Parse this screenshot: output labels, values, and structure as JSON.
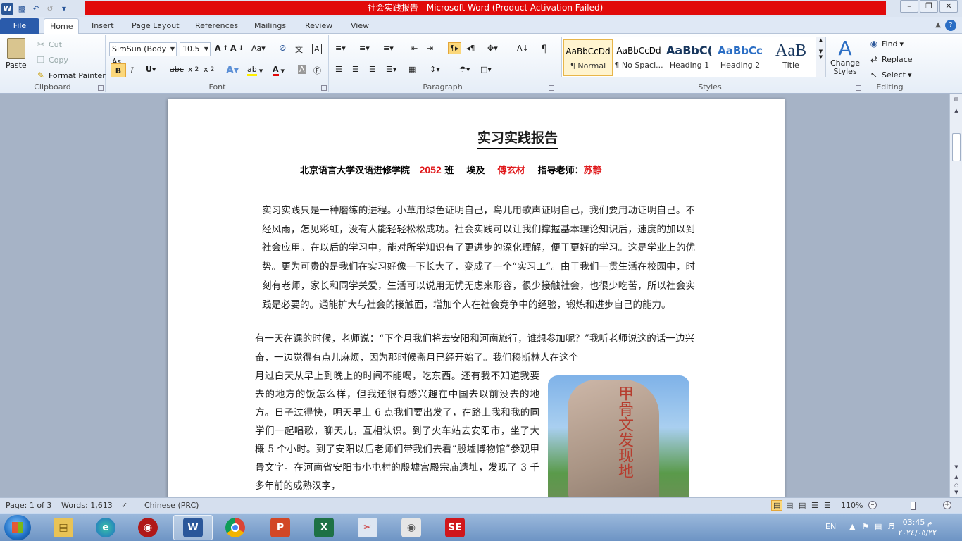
{
  "window": {
    "title": "社会实践报告 - Microsoft Word (Product Activation Failed)"
  },
  "tabs": [
    "File",
    "Home",
    "Insert",
    "Page Layout",
    "References",
    "Mailings",
    "Review",
    "View"
  ],
  "clipboard": {
    "paste": "Paste",
    "cut": "Cut",
    "copy": "Copy",
    "format_painter": "Format Painter",
    "label": "Clipboard"
  },
  "font": {
    "name": "SimSun (Body As",
    "size": "10.5",
    "label": "Font"
  },
  "paragraph": {
    "label": "Paragraph"
  },
  "styles": {
    "label": "Styles",
    "items": [
      {
        "sample": "AaBbCcDd",
        "name": "¶ Normal"
      },
      {
        "sample": "AaBbCcDd",
        "name": "¶ No Spaci..."
      },
      {
        "sample": "AaBbC(",
        "name": "Heading 1"
      },
      {
        "sample": "AaBbCc",
        "name": "Heading 2"
      },
      {
        "sample": "AaB",
        "name": "Title"
      }
    ],
    "change_styles": "Change Styles"
  },
  "editing": {
    "find": "Find",
    "replace": "Replace",
    "select": "Select",
    "label": "Editing"
  },
  "document": {
    "title": "实习实践报告",
    "subtitle_school": "北京语言大学汉语进修学院",
    "subtitle_class_num": "2052",
    "subtitle_class": "班",
    "subtitle_country": "埃及",
    "subtitle_name": "傅玄材",
    "subtitle_teacher_label": "指导老师：",
    "subtitle_teacher": "苏静",
    "para1": "实习实践只是一种磨练的进程。小草用绿色证明自己，鸟儿用歌声证明自己，我们要用动证明自己。不经风雨，怎见彩虹，没有人能轻轻松松成功。社会实践可以让我们撑握基本理论知识后，速度的加以到社会应用。在以后的学习中，能对所学知识有了更进步的深化理解，便于更好的学习。这是学业上的优势。更为可贵的是我们在实习好像一下长大了，变成了一个“实习工”。由于我们一贯生活在校园中，时刻有老师，家长和同学关爱，生活可以说用无忧无虑来形容，很少接触社会，也很少吃苦，所以社会实践是必要的。通能扩大与社会的接触面，增加个人在社会竞争中的经验，锻炼和进步自己的能力。",
    "para2": "有一天在课的时候，老师说：“下个月我们将去安阳和河南旅行，谁想参加呢？”我听老师说这的话一边兴奋，一边觉得有点儿麻烦，因为那时候斋月已经开始了。我们穆斯林人在这个",
    "para3": "月过白天从早上到晚上的时间不能喝，吃东西。还有我不知道我要去的地方的饭怎么样，但我还很有感兴趣在中国去以前没去的地方。日子过得快，明天早上 6 点我们要出发了，在路上我和我的同学们一起唱歌，聊天儿，互相认识。到了火车站去安阳市，坐了大概 5 个小时。到了安阳以后老师们带我们去看“殷墟博物馆”参观甲骨文字。在河南省安阳市小屯村的殷墟宫殿宗庙遗址，发现了 3 千多年前的成熟汉字，",
    "photo_text": "甲骨文发现地"
  },
  "status": {
    "page": "Page: 1 of 3",
    "words": "Words: 1,613",
    "language": "Chinese (PRC)",
    "zoom": "110%"
  },
  "taskbar": {
    "lang": "EN",
    "time": "03:45 م",
    "date": "٢٠٢٤/٠٥/٢٢"
  },
  "colors": {
    "accent_red": "#e0181b",
    "file_tab": "#2a5bab",
    "title_bar": "#e10a0a"
  }
}
